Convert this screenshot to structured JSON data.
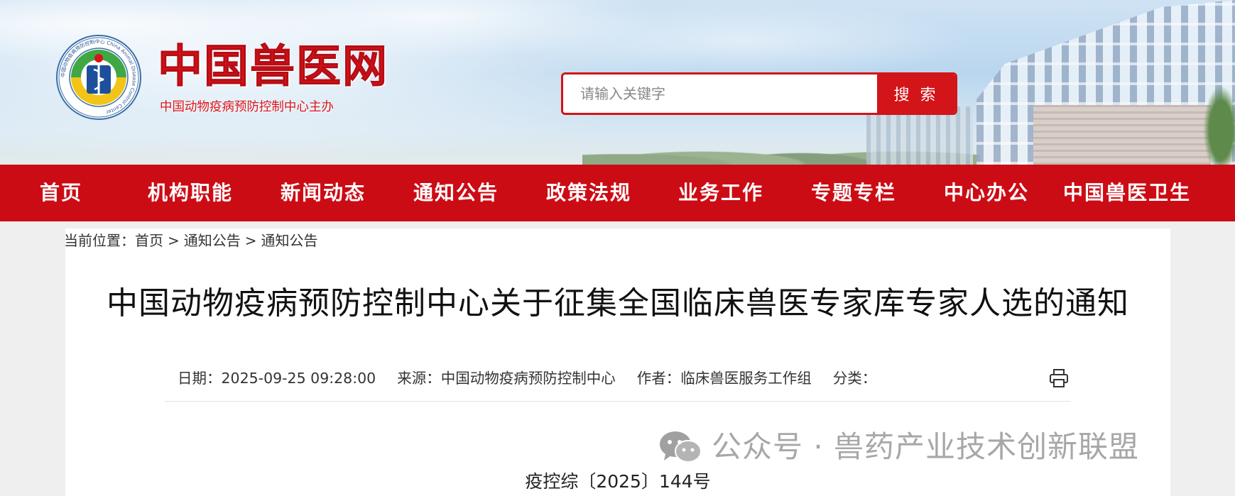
{
  "header": {
    "logo_title": "中国兽医网",
    "logo_subtitle": "中国动物疫病预防控制中心主办",
    "emblem_ring_text": "中国动物疫病预防控制中心 China Animal Disease Control Center",
    "search": {
      "placeholder": "请输入关键字",
      "button_label": "搜 索"
    }
  },
  "nav": {
    "items": [
      {
        "label": "首页"
      },
      {
        "label": "机构职能"
      },
      {
        "label": "新闻动态"
      },
      {
        "label": "通知公告"
      },
      {
        "label": "政策法规"
      },
      {
        "label": "业务工作"
      },
      {
        "label": "专题专栏"
      },
      {
        "label": "中心办公"
      },
      {
        "label": "中国兽医卫生"
      }
    ]
  },
  "breadcrumb": {
    "prefix": "当前位置：",
    "items": [
      "首页",
      "通知公告",
      "通知公告"
    ],
    "separator": ">"
  },
  "article": {
    "title": "中国动物疫病预防控制中心关于征集全国临床兽医专家库专家人选的通知",
    "meta": {
      "date": "日期：2025-09-25 09:28:00",
      "source": "来源：中国动物疫病预防控制中心",
      "author": "作者：临床兽医服务工作组",
      "category": "分类："
    },
    "doc_number": "疫控综〔2025〕144号"
  },
  "watermark": {
    "text": "公众号 · 兽药产业技术创新联盟"
  },
  "colors": {
    "brand_red": "#cc0c15",
    "search_red": "#d31418"
  },
  "icons": [
    "emblem-logo-icon",
    "print-icon",
    "wechat-icon"
  ]
}
